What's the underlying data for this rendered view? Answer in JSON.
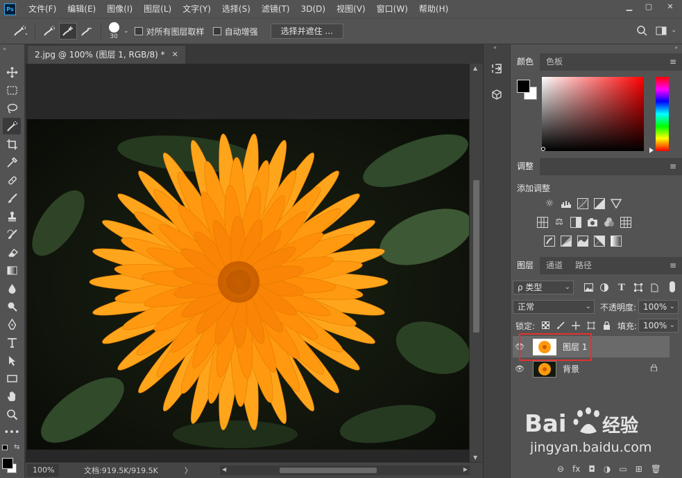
{
  "app": {
    "logo": "Ps"
  },
  "menu": [
    "文件(F)",
    "编辑(E)",
    "图像(I)",
    "图层(L)",
    "文字(Y)",
    "选择(S)",
    "滤镜(T)",
    "3D(D)",
    "视图(V)",
    "窗口(W)",
    "帮助(H)"
  ],
  "window_controls": {
    "minimize": "▁",
    "maximize": "▢",
    "close": "✕"
  },
  "options_bar": {
    "brush_size": "30",
    "sample_all_layers_label": "对所有图层取样",
    "sample_all_layers_checked": false,
    "auto_enhance_label": "自动增强",
    "auto_enhance_checked": false,
    "select_and_mask_label": "选择并遮住 ..."
  },
  "toolbox": {
    "tools": [
      "move-tool",
      "marquee-tool",
      "lasso-tool",
      "quick-selection-tool",
      "crop-tool",
      "eyedropper-tool",
      "healing-brush-tool",
      "brush-tool",
      "clone-stamp-tool",
      "history-brush-tool",
      "eraser-tool",
      "gradient-tool",
      "blur-tool",
      "dodge-tool",
      "pen-tool",
      "type-tool",
      "path-selection-tool",
      "rectangle-tool",
      "hand-tool",
      "zoom-tool",
      "edit-toolbar"
    ],
    "active_tool": "quick-selection-tool",
    "foreground_color": "#000000",
    "background_color": "#ffffff"
  },
  "document": {
    "tab_title": "2.jpg @ 100% (图层 1, RGB/8) *",
    "tab_close": "✕",
    "zoom": "100%",
    "doc_size": "文档:919.5K/919.5K",
    "status_arrow": "〉"
  },
  "color_panel": {
    "tabs": [
      "颜色",
      "色板"
    ],
    "active_tab": "颜色",
    "hue_color": "#ff0000"
  },
  "adjustments_panel": {
    "title": "调整",
    "add_label": "添加调整"
  },
  "layers_panel": {
    "tabs": [
      "图层",
      "通道",
      "路径"
    ],
    "active_tab": "图层",
    "filter_kind": "ρ 类型",
    "blend_mode": "正常",
    "opacity_label": "不透明度:",
    "opacity_value": "100%",
    "lock_label": "锁定:",
    "fill_label": "填充:",
    "fill_value": "100%",
    "layers": [
      {
        "name": "图层 1",
        "selected": true,
        "locked": false
      },
      {
        "name": "背景",
        "selected": false,
        "locked": true
      }
    ],
    "footer_icons": [
      "link-icon",
      "fx-icon",
      "mask-icon",
      "adjustment-icon",
      "group-icon",
      "new-layer-icon",
      "delete-icon"
    ],
    "footer_labels": [
      "⊖",
      "fx",
      "◘",
      "◑",
      "▭",
      "⊞",
      "🗑"
    ]
  },
  "watermark": {
    "text": "jingyan.baidu.com"
  },
  "panel_menu_glyph": "≡"
}
